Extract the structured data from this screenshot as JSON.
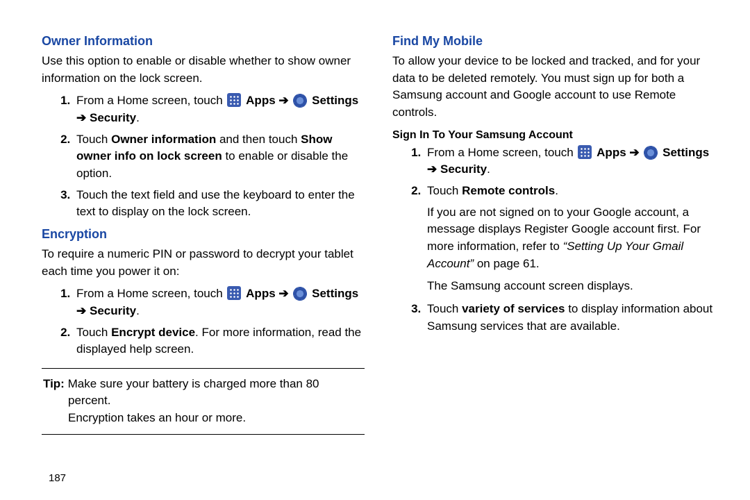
{
  "page_number": "187",
  "left": {
    "owner": {
      "heading": "Owner Information",
      "intro": "Use this option to enable or disable whether to show owner information on the lock screen.",
      "step1a": "From a Home screen, touch ",
      "apps": "Apps",
      "settings": "Settings",
      "security": "Security",
      "step2a": "Touch ",
      "step2_bold1": "Owner information",
      "step2b": " and then touch ",
      "step2_bold2": "Show owner info on lock screen",
      "step2c": " to enable or disable the option.",
      "step3": "Touch the text field and use the keyboard to enter the text to display on the lock screen."
    },
    "encryption": {
      "heading": "Encryption",
      "intro": "To require a numeric PIN or password to decrypt your tablet each time you power it on:",
      "step1a": "From a Home screen, touch ",
      "apps": "Apps",
      "settings": "Settings",
      "security": "Security",
      "step2a": "Touch ",
      "step2_bold": "Encrypt device",
      "step2b": ". For more information, read the displayed help screen."
    },
    "tip_label": "Tip:",
    "tip_line1": " Make sure your battery is charged more than 80 percent.",
    "tip_line2": "Encryption takes an hour or more."
  },
  "right": {
    "find": {
      "heading": "Find My Mobile",
      "intro": "To allow your device to be locked and tracked, and for your data to be deleted remotely. You must sign up for both a Samsung account and Google account to use Remote controls."
    },
    "signin": {
      "heading": "Sign In To Your Samsung Account",
      "step1a": "From a Home screen, touch ",
      "apps": "Apps",
      "settings": "Settings",
      "security": "Security",
      "step2a": "Touch ",
      "step2_bold": "Remote controls",
      "step2b": ".",
      "post2a": "If you are not signed on to your Google account, a message displays Register Google account first. For more information, refer to ",
      "post2_ital": "“Setting Up Your Gmail Account”",
      "post2b": "  on page 61.",
      "post2c": "The Samsung account screen displays.",
      "step3a": "Touch ",
      "step3_bold": "variety of services",
      "step3b": " to display information about Samsung services that are available."
    }
  },
  "arrow": "➔"
}
